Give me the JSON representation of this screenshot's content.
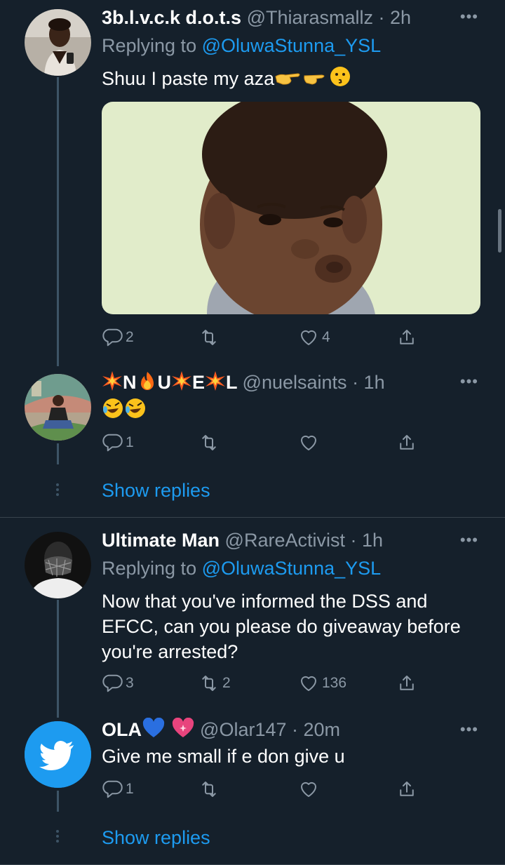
{
  "tweets": [
    {
      "name": "3b.l.v.c.k d.o.t.s",
      "handle": "@Thiarasmallz",
      "time": "· 2h",
      "reply_prefix": "Replying to ",
      "reply_to": "@OluwaStunna_YSL",
      "text": "Shuu I paste my aza",
      "actions": {
        "reply": "2",
        "retweet": "",
        "like": "4"
      }
    },
    {
      "name_letters": [
        "N",
        "U",
        "E",
        "L"
      ],
      "handle": "@nuelsaints",
      "time": "· 1h",
      "actions": {
        "reply": "1",
        "retweet": "",
        "like": ""
      }
    },
    {
      "name": "Ultimate Man",
      "handle": "@RareActivist",
      "time": "· 1h",
      "reply_prefix": "Replying to ",
      "reply_to": "@OluwaStunna_YSL",
      "text_lines": [
        "Now that you've informed the DSS and",
        "EFCC, can you please do giveaway before",
        "you're arrested?"
      ],
      "actions": {
        "reply": "3",
        "retweet": "2",
        "like": "136"
      }
    },
    {
      "name": "OLA",
      "handle": "@Olar147",
      "time": "· 20m",
      "text": "Give me small if e don give u",
      "actions": {
        "reply": "1",
        "retweet": "",
        "like": ""
      }
    }
  ],
  "show_replies_label": "Show replies",
  "more_label": "•••",
  "colors": {
    "background": "#15202b",
    "link": "#1d9bf0",
    "muted": "#8b98a5",
    "thread_line": "#3d5466"
  },
  "icons": [
    "reply-icon",
    "retweet-icon",
    "like-icon",
    "share-icon",
    "more-icon",
    "twitter-bird-icon"
  ]
}
